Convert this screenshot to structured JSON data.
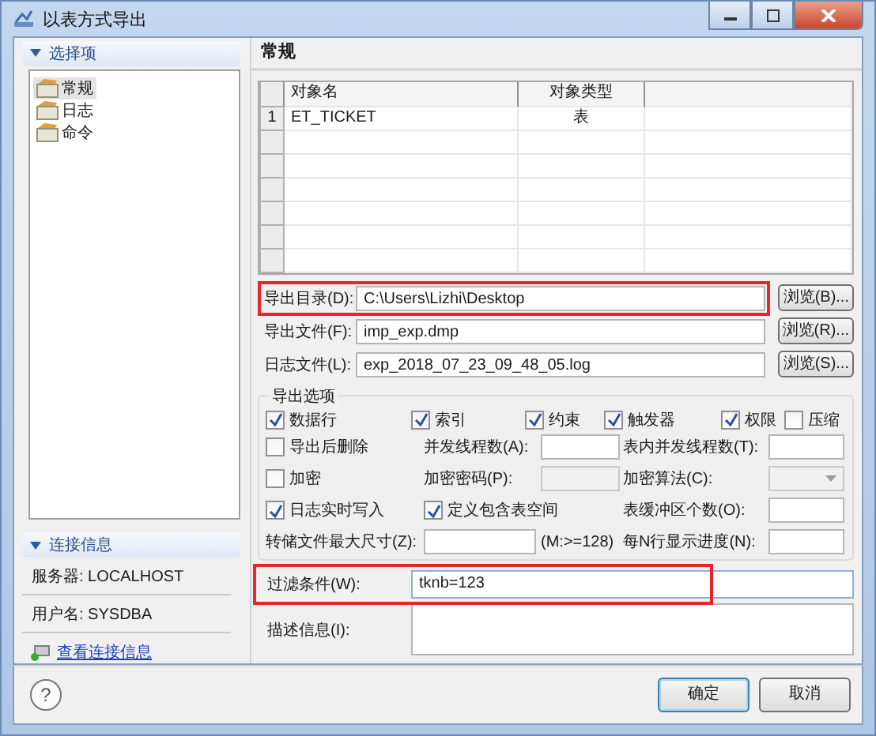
{
  "window": {
    "title": "以表方式导出"
  },
  "sidebar": {
    "header": "选择项",
    "items": [
      {
        "label": "常规",
        "selected": true
      },
      {
        "label": "日志",
        "selected": false
      },
      {
        "label": "命令",
        "selected": false
      }
    ]
  },
  "connection": {
    "header": "连接信息",
    "rows": [
      "服务器: LOCALHOST",
      "用户名: SYSDBA"
    ],
    "link": "查看连接信息"
  },
  "page": {
    "title": "常规"
  },
  "table": {
    "columns": [
      "对象名",
      "对象类型"
    ],
    "rows": [
      {
        "index": "1",
        "cells": [
          "ET_TICKET",
          "表"
        ]
      }
    ]
  },
  "paths": [
    {
      "label": "导出目录(D):",
      "value": "C:\\Users\\Lizhi\\Desktop",
      "button": "浏览(B)...",
      "highlighted": true
    },
    {
      "label": "导出文件(F):",
      "value": "imp_exp.dmp",
      "button": "浏览(R)...",
      "highlighted": false
    },
    {
      "label": "日志文件(L):",
      "value": "exp_2018_07_23_09_48_05.log",
      "button": "浏览(S)...",
      "highlighted": false
    }
  ],
  "options": {
    "title": "导出选项",
    "flags": [
      {
        "label": "数据行",
        "checked": true
      },
      {
        "label": "索引",
        "checked": true
      },
      {
        "label": "约束",
        "checked": true
      },
      {
        "label": "触发器",
        "checked": true
      },
      {
        "label": "权限",
        "checked": true
      },
      {
        "label": "压缩",
        "checked": false
      }
    ],
    "rows": [
      [
        {
          "kind": "checkbox",
          "label": "导出后删除",
          "checked": false
        },
        {
          "kind": "label",
          "text": "并发线程数(A):"
        },
        {
          "kind": "input",
          "disabled": false
        },
        {
          "kind": "label",
          "text": "表内并发线程数(T):"
        },
        {
          "kind": "input",
          "disabled": false
        }
      ],
      [
        {
          "kind": "checkbox",
          "label": "加密",
          "checked": false
        },
        {
          "kind": "label",
          "text": "加密密码(P):"
        },
        {
          "kind": "input",
          "disabled": true
        },
        {
          "kind": "label",
          "text": "加密算法(C):"
        },
        {
          "kind": "select",
          "disabled": true
        }
      ],
      [
        {
          "kind": "checkbox",
          "label": "日志实时写入",
          "checked": true
        },
        {
          "kind": "checkbox",
          "label": "定义包含表空间",
          "checked": true
        },
        null,
        {
          "kind": "label",
          "text": "表缓冲区个数(O):"
        },
        {
          "kind": "input",
          "disabled": false
        }
      ],
      [
        {
          "kind": "label",
          "text": "转储文件最大尺寸(Z):"
        },
        {
          "kind": "input",
          "disabled": false
        },
        {
          "kind": "note",
          "text": "(M:>=128)"
        },
        {
          "kind": "label",
          "text": "每N行显示进度(N):"
        },
        {
          "kind": "input",
          "disabled": false
        }
      ]
    ]
  },
  "filter": {
    "label": "过滤条件(W):",
    "value": "tknb=123",
    "highlighted": true
  },
  "description": {
    "label": "描述信息(I):"
  },
  "buttons": {
    "help": "?",
    "ok": "确定",
    "cancel": "取消"
  }
}
